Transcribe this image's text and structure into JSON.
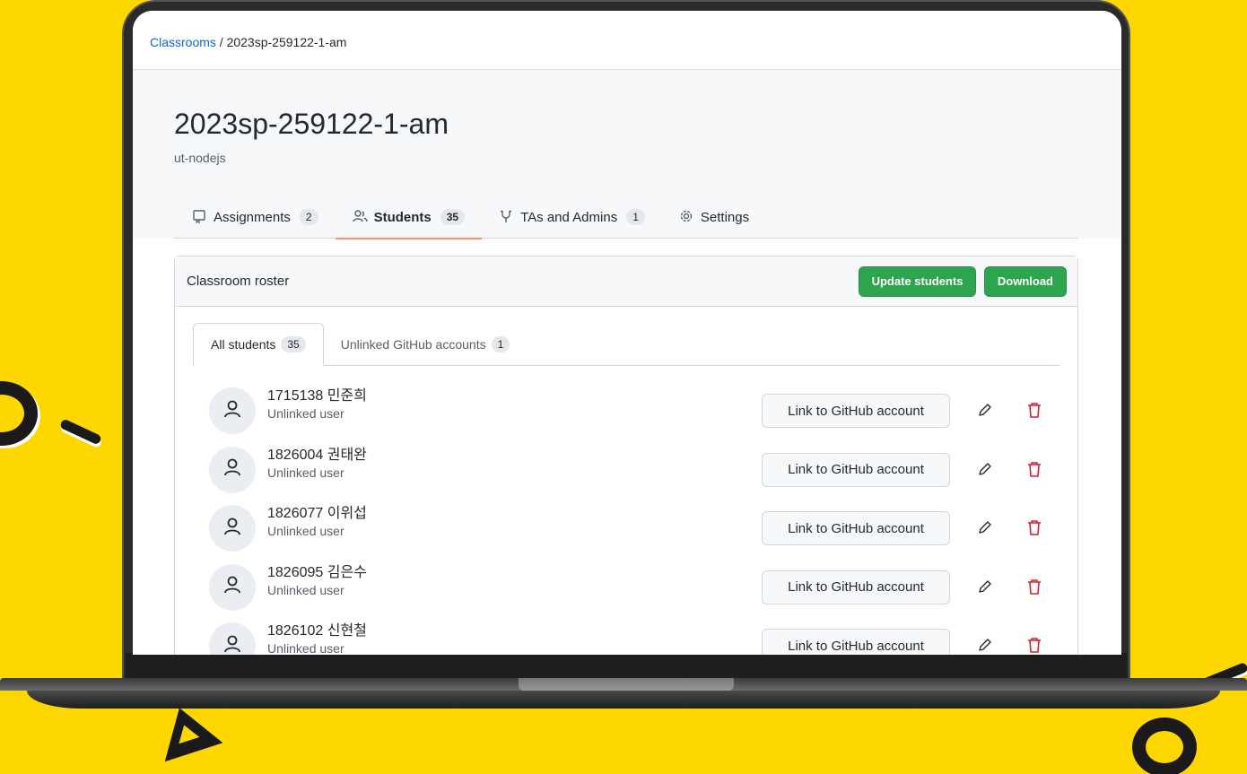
{
  "breadcrumb": {
    "root": "Classrooms",
    "separator": " / ",
    "current": "2023sp-259122-1-am"
  },
  "classroom": {
    "title": "2023sp-259122-1-am",
    "org": "ut-nodejs"
  },
  "tabs": [
    {
      "label": "Assignments",
      "count": "2",
      "icon": "notebook-icon"
    },
    {
      "label": "Students",
      "count": "35",
      "icon": "people-icon",
      "active": true
    },
    {
      "label": "TAs and Admins",
      "count": "1",
      "icon": "mortarboard-icon"
    },
    {
      "label": "Settings",
      "count": "",
      "icon": "gear-icon"
    }
  ],
  "roster": {
    "title": "Classroom roster",
    "update_label": "Update students",
    "download_label": "Download",
    "subtabs": [
      {
        "label": "All students",
        "count": "35",
        "active": true
      },
      {
        "label": "Unlinked GitHub accounts",
        "count": "1"
      }
    ],
    "students": [
      {
        "name": "1715138 민준희",
        "status": "Unlinked user",
        "action": "Link to GitHub account"
      },
      {
        "name": "1826004 권태완",
        "status": "Unlinked user",
        "action": "Link to GitHub account"
      },
      {
        "name": "1826077 이위섭",
        "status": "Unlinked user",
        "action": "Link to GitHub account"
      },
      {
        "name": "1826095 김은수",
        "status": "Unlinked user",
        "action": "Link to GitHub account"
      },
      {
        "name": "1826102 신현철",
        "status": "Unlinked user",
        "action": "Link to GitHub account"
      }
    ]
  },
  "colors": {
    "background": "#FFD700",
    "green_button": "#2da44e",
    "active_tab_underline": "#fd8c73",
    "delete": "#cf222e"
  }
}
